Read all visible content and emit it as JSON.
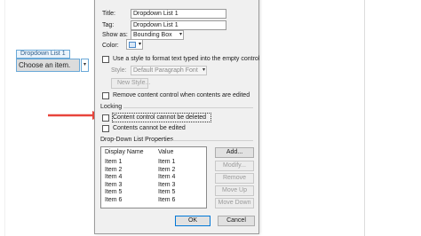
{
  "document": {
    "content_control": {
      "tab_title": "Dropdown List 1",
      "placeholder": "Choose an item.",
      "dropdown_glyph": "▾"
    }
  },
  "dialog": {
    "title_label": "Title:",
    "title_value": "Dropdown List 1",
    "tag_label": "Tag:",
    "tag_value": "Dropdown List 1",
    "show_as_label": "Show as:",
    "show_as_value": "Bounding Box",
    "color_label": "Color:",
    "use_style_label": "Use a style to format text typed into the empty control",
    "style_label": "Style:",
    "style_value": "Default Paragraph Font",
    "new_style_button": "New Style...",
    "remove_when_edited_label": "Remove content control when contents are edited",
    "locking_header": "Locking",
    "cannot_delete_label": "Content control cannot be deleted",
    "cannot_edit_label": "Contents cannot be edited",
    "dropdown_props_header": "Drop-Down List Properties",
    "list": {
      "columns": [
        "Display Name",
        "Value"
      ],
      "rows": [
        [
          "Item 1",
          "Item 1"
        ],
        [
          "Item 2",
          "Item 2"
        ],
        [
          "Item 4",
          "Item 4"
        ],
        [
          "Item 3",
          "Item 3"
        ],
        [
          "Item 5",
          "Item 5"
        ],
        [
          "Item 6",
          "Item 6"
        ]
      ]
    },
    "buttons": {
      "add": "Add...",
      "modify": "Modify...",
      "remove": "Remove",
      "move_up": "Move Up",
      "move_down": "Move Down",
      "ok": "OK",
      "cancel": "Cancel"
    },
    "chevron": "▾"
  },
  "colors": {
    "arrow": "#e8453c",
    "control_border": "#6aa9d8",
    "ok_border": "#0078d7"
  }
}
